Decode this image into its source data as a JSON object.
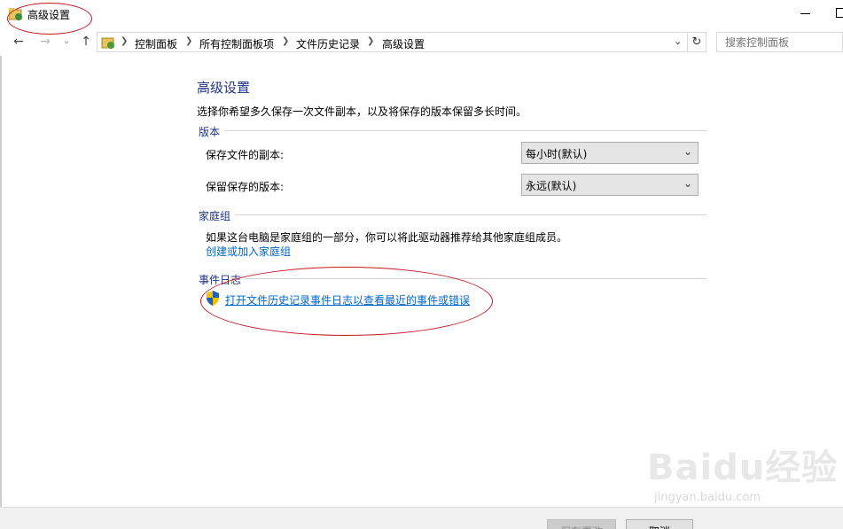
{
  "window": {
    "title": "高级设置"
  },
  "address_bar": {
    "breadcrumbs": [
      "控制面板",
      "所有控制面板项",
      "文件历史记录",
      "高级设置"
    ]
  },
  "search": {
    "placeholder": "搜索控制面板"
  },
  "main": {
    "title": "高级设置",
    "description": "选择你希望多久保存一次文件副本，以及将保存的版本保留多长时间。",
    "versions": {
      "heading": "版本",
      "save_copies_label": "保存文件的副本:",
      "save_copies_value": "每小时(默认)",
      "keep_versions_label": "保留保存的版本:",
      "keep_versions_value": "永远(默认)"
    },
    "homegroup": {
      "heading": "家庭组",
      "text": "如果这台电脑是家庭组的一部分，你可以将此驱动器推荐给其他家庭组成员。",
      "link": "创建或加入家庭组"
    },
    "event_log": {
      "heading": "事件日志",
      "link": "打开文件历史记录事件日志以查看最近的事件或错误"
    }
  },
  "footer": {
    "save_button": "保存更改",
    "cancel_button": "取消"
  },
  "watermark": {
    "main": "Baidu经验",
    "sub": "jingyan.baidu.com"
  },
  "colors": {
    "heading_blue": "#1e3287",
    "link_blue": "#0066cc",
    "annotation_red": "#c8141e"
  }
}
